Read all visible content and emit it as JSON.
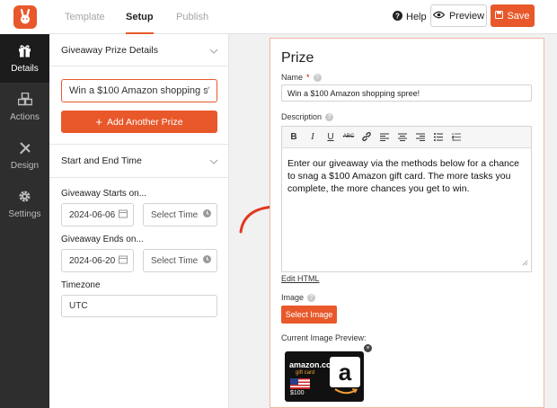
{
  "tabs": {
    "template": "Template",
    "setup": "Setup",
    "publish": "Publish"
  },
  "header": {
    "help": "Help",
    "preview": "Preview",
    "save": "Save"
  },
  "nav": {
    "details": "Details",
    "actions": "Actions",
    "design": "Design",
    "settings": "Settings"
  },
  "panel": {
    "prize_section": "Giveaway Prize Details",
    "prize_name_value": "Win a $100 Amazon shopping spree!",
    "add_prize": "Add Another Prize",
    "dates_section": "Start and End Time",
    "starts_label": "Giveaway Starts on...",
    "start_date": "2024-06-06",
    "start_time_placeholder": "Select Time",
    "ends_label": "Giveaway Ends on...",
    "end_date": "2024-06-20",
    "end_time_placeholder": "Select Time",
    "timezone_label": "Timezone",
    "timezone_value": "UTC"
  },
  "preview": {
    "title": "Prize",
    "name_label": "Name",
    "required_mark": "*",
    "name_value": "Win a $100 Amazon shopping spree!",
    "description_label": "Description",
    "description_text": "Enter our giveaway via the methods below for a chance to snag a $100 Amazon gift card. The more tasks you complete, the more chances you get to win.",
    "edit_html": "Edit HTML",
    "image_label": "Image",
    "select_image": "Select Image",
    "current_image_label": "Current Image Preview:",
    "giftcard": {
      "brand": "amazon.com",
      "subtitle": "gift card",
      "amount": "$100"
    }
  },
  "colors": {
    "accent": "#e8582b",
    "sidebar": "#2e2e2e"
  }
}
